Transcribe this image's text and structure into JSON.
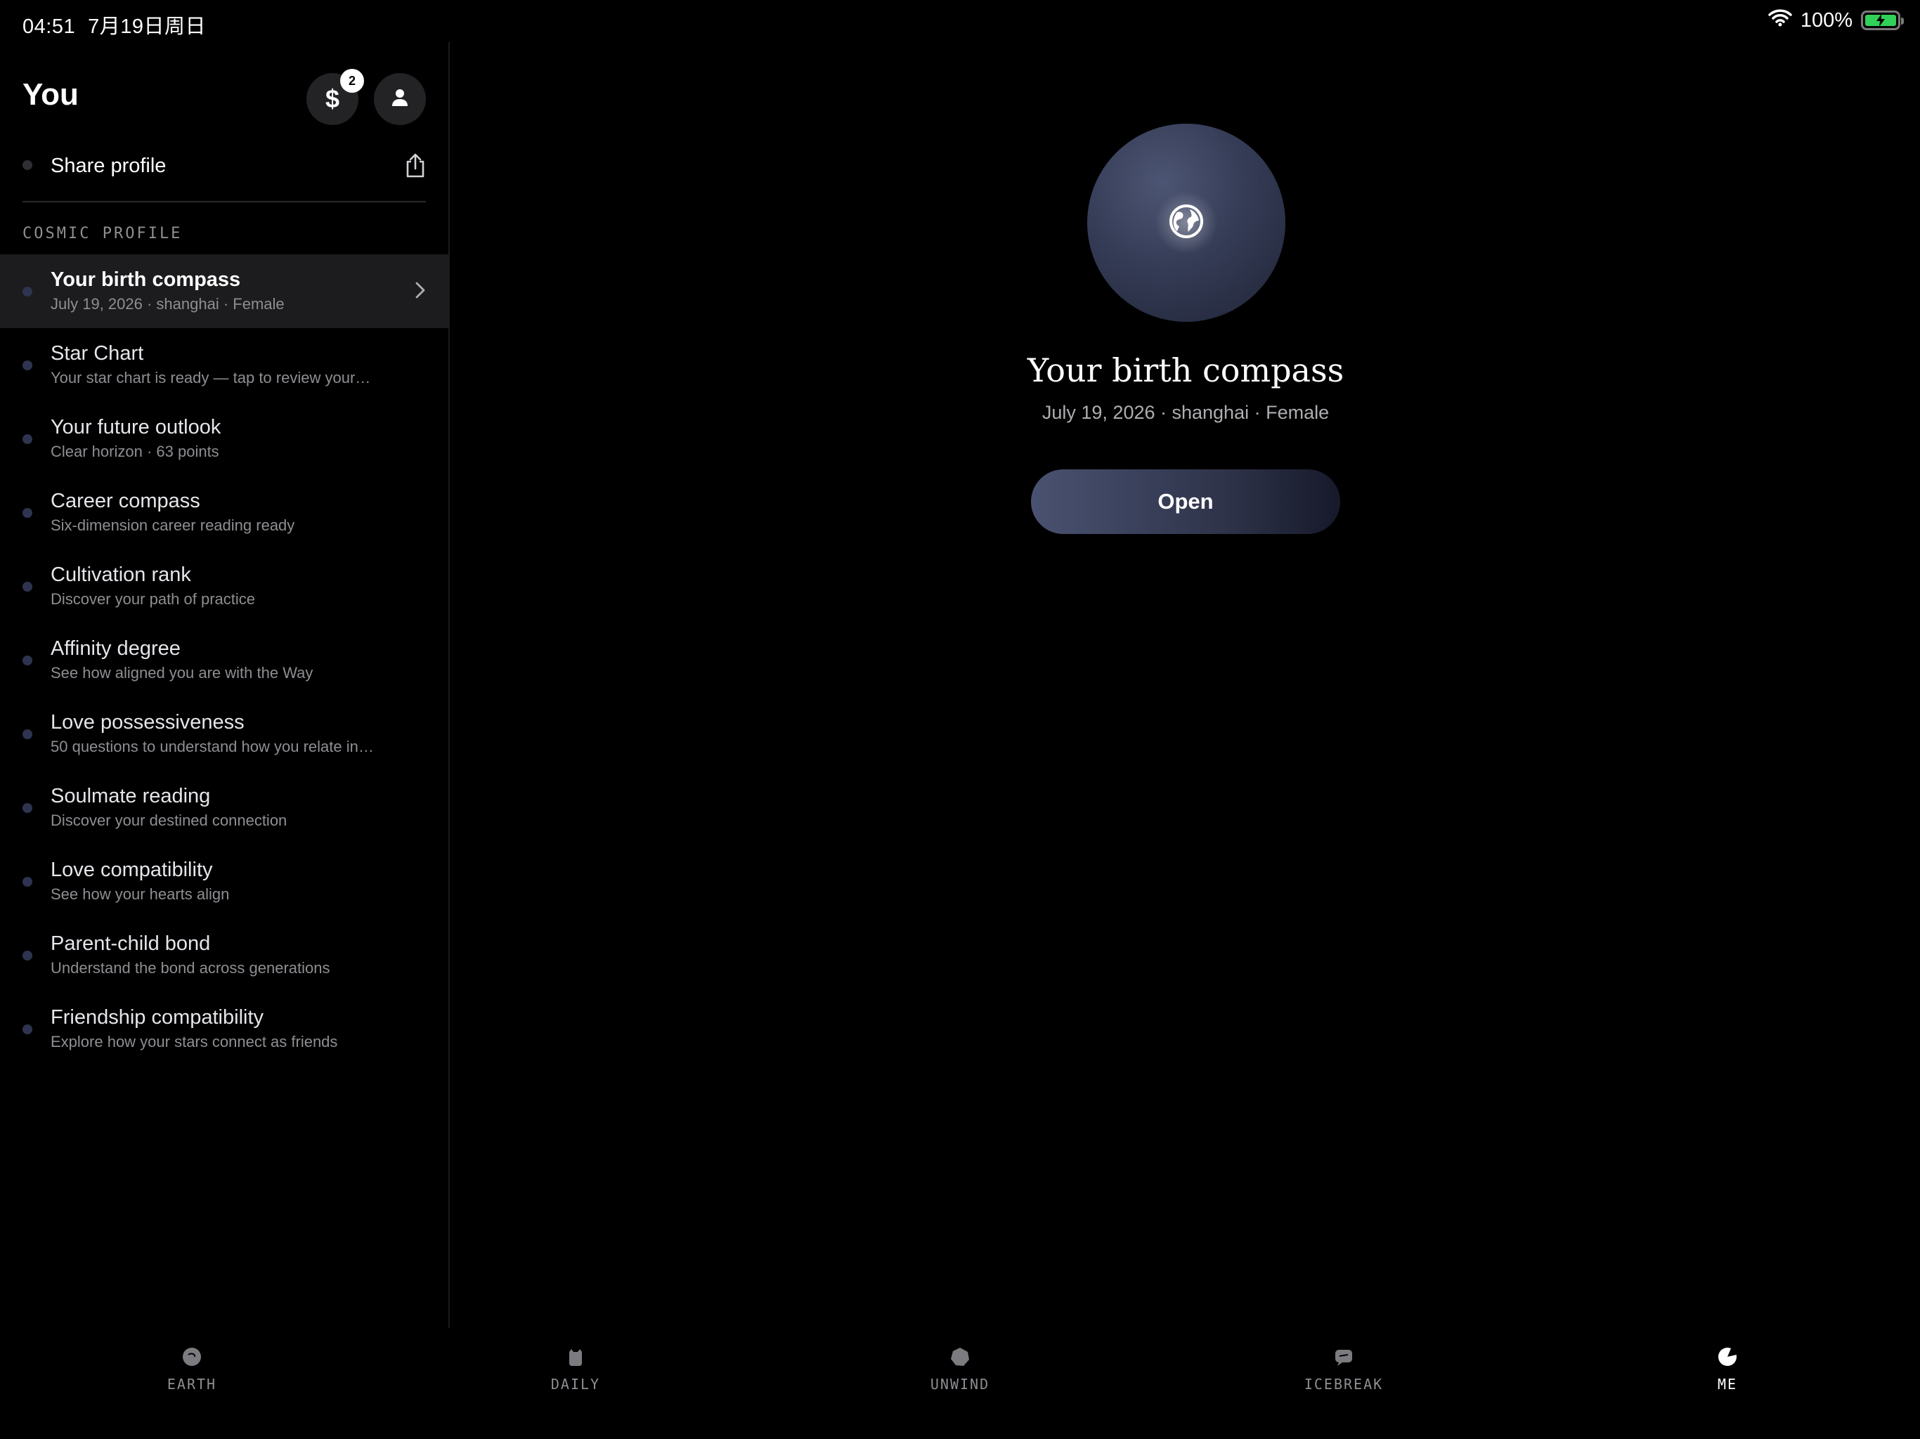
{
  "status_bar": {
    "time": "04:51",
    "date": "7月19日周日",
    "battery_text": "100%",
    "battery_level": 1.0,
    "battery_color": "#30d158"
  },
  "sidebar": {
    "title": "You",
    "coin_symbol": "$",
    "coin_badge": "2",
    "share_label": "Share profile",
    "section_label": "COSMIC PROFILE",
    "items": [
      {
        "title": "Your birth compass",
        "subtitle": "July 19, 2026 · shanghai · Female",
        "active": true
      },
      {
        "title": "Star Chart",
        "subtitle": "Your star chart is ready — tap to review your…"
      },
      {
        "title": "Your future outlook",
        "subtitle": "Clear horizon · 63 points"
      },
      {
        "title": "Career compass",
        "subtitle": "Six-dimension career reading ready"
      },
      {
        "title": "Cultivation rank",
        "subtitle": "Discover your path of practice"
      },
      {
        "title": "Affinity degree",
        "subtitle": "See how aligned you are with the Way"
      },
      {
        "title": "Love possessiveness",
        "subtitle": "50 questions to understand how you relate in…"
      },
      {
        "title": "Soulmate reading",
        "subtitle": "Discover your destined connection"
      },
      {
        "title": "Love compatibility",
        "subtitle": "See how your hearts align"
      },
      {
        "title": "Parent-child bond",
        "subtitle": "Understand the bond across generations"
      },
      {
        "title": "Friendship compatibility",
        "subtitle": "Explore how your stars connect as friends"
      }
    ]
  },
  "detail": {
    "icon": "globe-icon",
    "title": "Your birth compass",
    "meta": "July 19, 2026 · shanghai · Female",
    "open_label": "Open"
  },
  "tabs": [
    {
      "label": "EARTH",
      "icon": "earth-icon"
    },
    {
      "label": "DAILY",
      "icon": "daily-icon"
    },
    {
      "label": "UNWIND",
      "icon": "unwind-icon"
    },
    {
      "label": "ICEBREAK",
      "icon": "icebreak-icon"
    },
    {
      "label": "ME",
      "icon": "me-icon",
      "active": true
    }
  ]
}
